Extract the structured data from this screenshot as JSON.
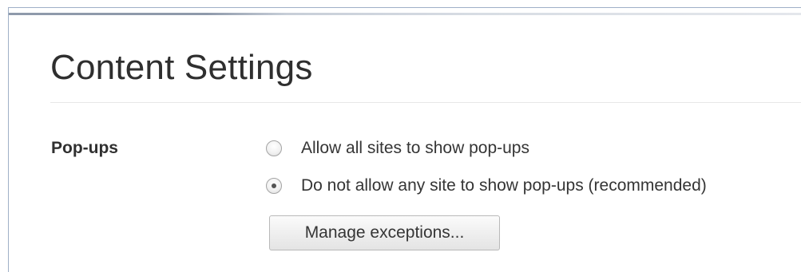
{
  "page": {
    "title": "Content Settings"
  },
  "popups": {
    "label": "Pop-ups",
    "options": [
      {
        "label": "Allow all sites to show pop-ups",
        "selected": false
      },
      {
        "label": "Do not allow any site to show pop-ups (recommended)",
        "selected": true
      }
    ],
    "manage_exceptions_label": "Manage exceptions..."
  }
}
